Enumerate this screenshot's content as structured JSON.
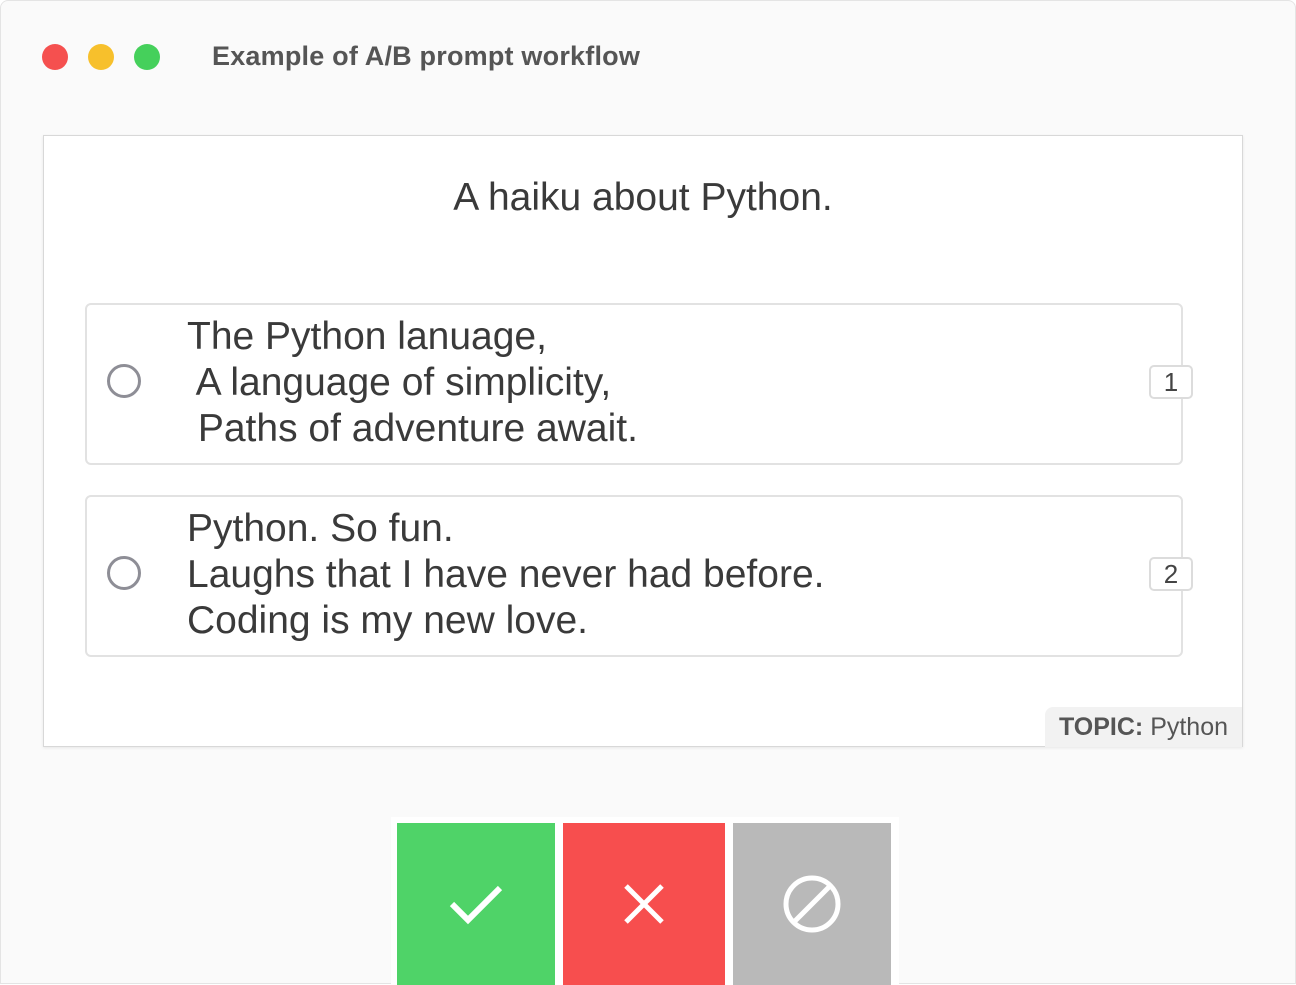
{
  "window": {
    "title": "Example of A/B prompt workflow",
    "controls": [
      "close",
      "minimize",
      "maximize"
    ]
  },
  "task": {
    "question": "A haiku about Python.",
    "options": [
      {
        "lines": [
          "The Python lanuage,",
          " A language of simplicity,",
          " Paths of adventure await."
        ],
        "hotkey": "1"
      },
      {
        "lines": [
          "Python. So fun.",
          "Laughs that I have never had before.",
          "Coding is my new love."
        ],
        "hotkey": "2"
      }
    ],
    "topic_label": "TOPIC:",
    "topic_value": "Python"
  },
  "actions": {
    "accept_icon": "check-icon",
    "reject_icon": "x-icon",
    "ignore_icon": "no-entry-icon"
  },
  "colors": {
    "accept": "#4fd368",
    "reject": "#f74e4e",
    "ignore": "#b9b9b9",
    "close_dot": "#f5504f",
    "minimize_dot": "#f7c02c",
    "maximize_dot": "#45d05b"
  }
}
